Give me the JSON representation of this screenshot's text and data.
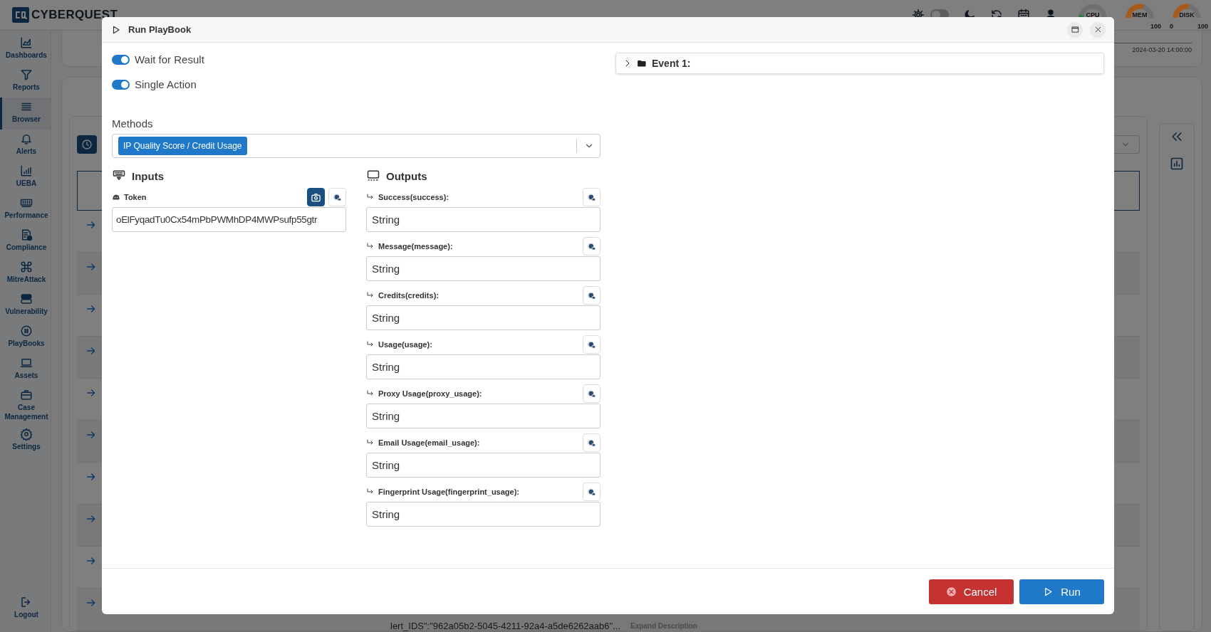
{
  "app": {
    "brand": "CYBERQUEST",
    "theme_toggle": {
      "on": false
    },
    "gauges": [
      {
        "label": "CPU",
        "level": 0.08,
        "color": "#2e7d32"
      },
      {
        "label": "MEM",
        "level": 0.6,
        "color": "#a85a1a",
        "max": "100"
      },
      {
        "label": "DISK",
        "level": 0.55,
        "color": "#a85a1a",
        "min": "0",
        "max": "100"
      }
    ],
    "nav": [
      {
        "label": "Dashboards",
        "selected": false
      },
      {
        "label": "Reports",
        "selected": false
      },
      {
        "label": "Browser",
        "selected": true
      },
      {
        "label": "Alerts",
        "selected": false
      },
      {
        "label": "UEBA",
        "selected": false
      },
      {
        "label": "Performance",
        "selected": false
      },
      {
        "label": "Compliance",
        "selected": false
      },
      {
        "label": "MitreAttack",
        "selected": false
      },
      {
        "label": "Vulnerability",
        "selected": false
      },
      {
        "label": "PlayBooks",
        "selected": false
      },
      {
        "label": "Assets",
        "selected": false
      },
      {
        "label": "Case Management",
        "selected": false
      },
      {
        "label": "Settings",
        "selected": false
      }
    ],
    "logout": "Logout",
    "timeline_label": "2024-03-20 14:00:00",
    "description_snippet": "lert_IDS\":\"962a05b2-5045-4211-92a4-a5de6262aab6\"...",
    "expand_label": "Expand Description"
  },
  "dialog": {
    "title": "Run PlayBook",
    "toggles": [
      {
        "label": "Wait for Result",
        "on": true
      },
      {
        "label": "Single Action",
        "on": true
      }
    ],
    "methods": {
      "label": "Methods",
      "selected": "IP Quality Score / Credit Usage"
    },
    "inputs": {
      "title": "Inputs",
      "fields": [
        {
          "label": "Token",
          "value": "oElFyqadTu0Cx54mPbPWMhDP4MWPsufp55gtr"
        }
      ]
    },
    "outputs": {
      "title": "Outputs",
      "fields": [
        {
          "label": "Success(success):",
          "value": "String"
        },
        {
          "label": "Message(message):",
          "value": "String"
        },
        {
          "label": "Credits(credits):",
          "value": "String"
        },
        {
          "label": "Usage(usage):",
          "value": "String"
        },
        {
          "label": "Proxy Usage(proxy_usage):",
          "value": "String"
        },
        {
          "label": "Email Usage(email_usage):",
          "value": "String"
        },
        {
          "label": "Fingerprint Usage(fingerprint_usage):",
          "value": "String"
        }
      ]
    },
    "event": {
      "label": "Event 1:",
      "expanded": false
    },
    "buttons": {
      "cancel": "Cancel",
      "run": "Run"
    }
  }
}
